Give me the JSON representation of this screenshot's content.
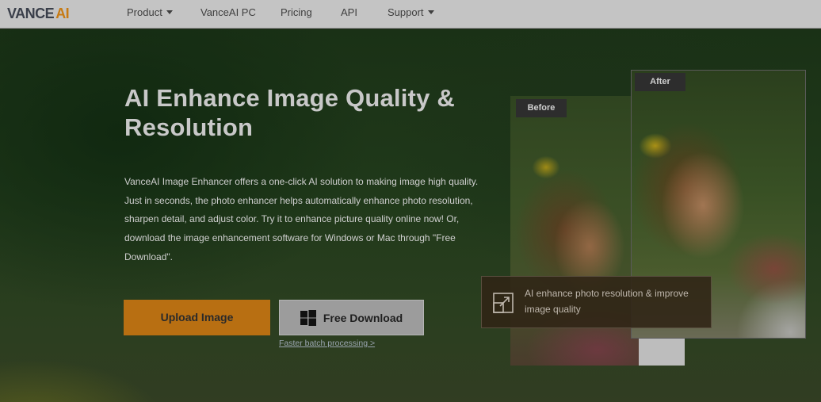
{
  "header": {
    "logo_main": "VANCE",
    "logo_accent": "AI",
    "nav": [
      {
        "label": "Product",
        "has_dropdown": true
      },
      {
        "label": "VanceAI PC",
        "has_dropdown": false
      },
      {
        "label": "Pricing",
        "has_dropdown": false
      },
      {
        "label": "API",
        "has_dropdown": false
      },
      {
        "label": "Support",
        "has_dropdown": true
      }
    ]
  },
  "hero": {
    "title": "AI Enhance Image Quality & Resolution",
    "description": "VanceAI Image Enhancer offers a one-click AI solution to making image high quality. Just in seconds, the photo enhancer helps automatically enhance photo resolution, sharpen detail, and adjust color. Try it to enhance picture quality online now! Or, download the image enhancement software for Windows or Mac through \"Free Download\".",
    "upload_label": "Upload Image",
    "download_label": "Free Download",
    "batch_link": "Faster batch processing >"
  },
  "comparison": {
    "before_label": "Before",
    "after_label": "After",
    "caption": "AI enhance photo resolution & improve image quality",
    "caption_icon": "expand-icon"
  },
  "colors": {
    "accent": "#b86f12",
    "logo_accent": "#c77a12",
    "header_bg": "#c4c4c4"
  }
}
